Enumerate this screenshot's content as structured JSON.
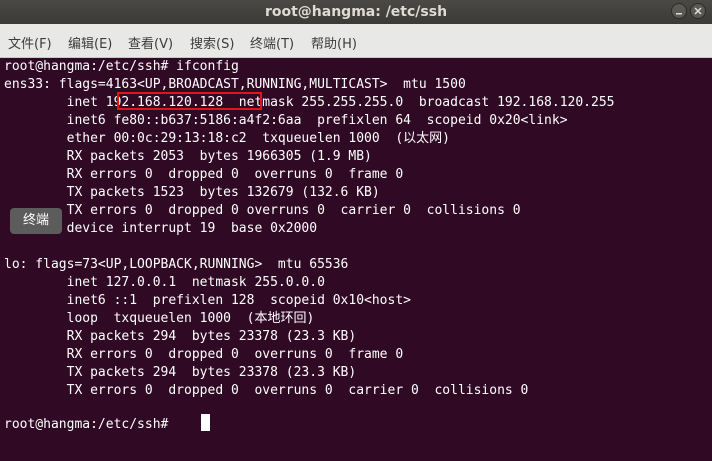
{
  "window": {
    "title": "root@hangma: /etc/ssh"
  },
  "menubar": {
    "items": [
      {
        "label": "文件(F)"
      },
      {
        "label": "编辑(E)"
      },
      {
        "label": "查看(V)"
      },
      {
        "label": "搜索(S)"
      },
      {
        "label": "终端(T)"
      },
      {
        "label": "帮助(H)"
      }
    ]
  },
  "terminal": {
    "lines": [
      "root@hangma:/etc/ssh# ifconfig",
      "ens33: flags=4163<UP,BROADCAST,RUNNING,MULTICAST>  mtu 1500",
      "        inet 192.168.120.128  netmask 255.255.255.0  broadcast 192.168.120.255",
      "        inet6 fe80::b637:5186:a4f2:6aa  prefixlen 64  scopeid 0x20<link>",
      "        ether 00:0c:29:13:18:c2  txqueuelen 1000  (以太网)",
      "        RX packets 2053  bytes 1966305 (1.9 MB)",
      "        RX errors 0  dropped 0  overruns 0  frame 0",
      "        TX packets 1523  bytes 132679 (132.6 KB)",
      "        TX errors 0  dropped 0 overruns 0  carrier 0  collisions 0",
      "        device interrupt 19  base 0x2000",
      "",
      "lo: flags=73<UP,LOOPBACK,RUNNING>  mtu 65536",
      "        inet 127.0.0.1  netmask 255.0.0.0",
      "        inet6 ::1  prefixlen 128  scopeid 0x10<host>",
      "        loop  txqueuelen 1000  (本地环回)",
      "        RX packets 294  bytes 23378 (23.3 KB)",
      "        RX errors 0  dropped 0  overruns 0  frame 0",
      "        TX packets 294  bytes 23378 (23.3 KB)",
      "        TX errors 0  dropped 0  overruns 0  carrier 0  collisions 0",
      "",
      "root@hangma:/etc/ssh# "
    ]
  },
  "tooltip": {
    "text": "终端"
  },
  "colors": {
    "terminal_bg": "#300a24",
    "highlight": "#e01616",
    "menubar_bg": "#e8e8e7",
    "titlebar_bg": "#3c3b37"
  }
}
